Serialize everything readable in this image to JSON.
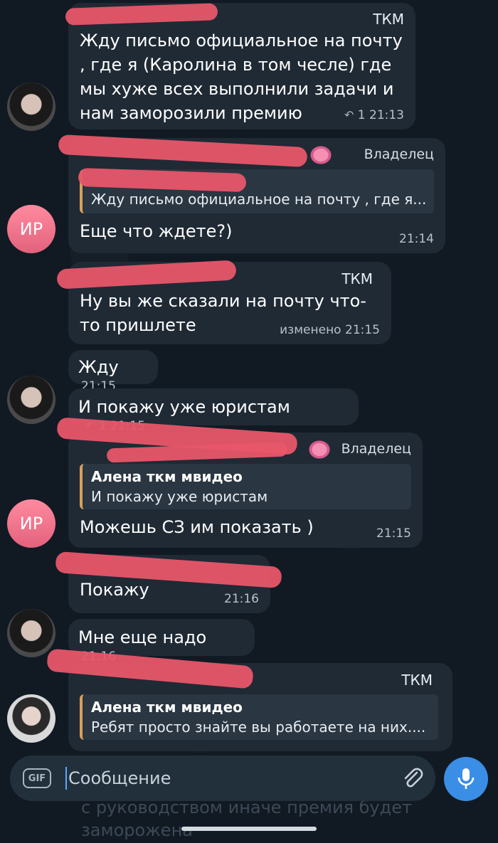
{
  "colors": {
    "background": "#111a23",
    "bubble": "#1f2a35",
    "quote_bar": "#d9a05b",
    "redaction": "#e8566a",
    "avatar_initials": "#e3617c",
    "mic_button": "#3a8ee6"
  },
  "messages": [
    {
      "tag": "ТКМ",
      "text": "Жду письмо официальное на почту , где я (Каролина в том чесле) где мы хуже всех выполнили задачи и нам заморозили премию",
      "replies": "1",
      "time": "21:13"
    },
    {
      "tag": "Владелец",
      "quote_text": "Жду письмо официальное на почту , где я...",
      "text": "Еще что ждете?)",
      "time": "21:14"
    },
    {
      "tag": "ТКМ",
      "text": "Ну вы же сказали на почту что-то пришлете",
      "edited": "изменено",
      "time": "21:15"
    },
    {
      "text": "Жду",
      "time": "21:15"
    },
    {
      "text": "И покажу уже юристам",
      "replies": "1",
      "time": "21:15"
    },
    {
      "tag": "Владелец",
      "quote_name": "Алена ткм мвидео",
      "quote_text": "И покажу уже юристам",
      "text": "Можешь СЗ им показать )",
      "time": "21:15"
    },
    {
      "text": "Покажу",
      "time": "21:16"
    },
    {
      "text": "Мне еще надо",
      "time": "21:16"
    },
    {
      "tag": "ТКМ",
      "quote_name": "Алена ткм мвидео",
      "quote_text": "Ребят просто знайте вы работаете на них...."
    }
  ],
  "avatars": {
    "initials": "ИР"
  },
  "ghost_lines": [
    "с руководством иначе премия будет",
    "заморожена"
  ],
  "composer": {
    "gif_label": "GIF",
    "placeholder": "Сообщение",
    "attach_icon": "paperclip-icon",
    "mic_icon": "microphone-icon"
  }
}
